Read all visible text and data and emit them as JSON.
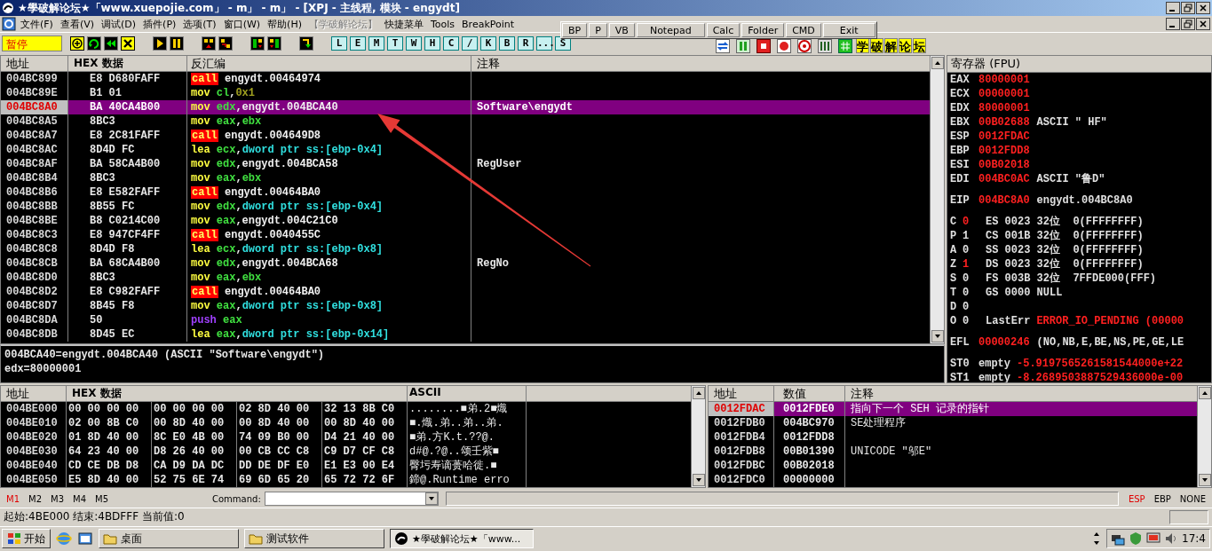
{
  "window": {
    "title": "★學破解论坛★「www.xuepojie.com」 - m」 - m」 - [XPJ - 主线程, 模块 - engydt]"
  },
  "menu": [
    {
      "label": "文件(F)",
      "disabled": false
    },
    {
      "label": "查看(V)",
      "disabled": false
    },
    {
      "label": "调试(D)",
      "disabled": false
    },
    {
      "label": "插件(P)",
      "disabled": false
    },
    {
      "label": "选项(T)",
      "disabled": false
    },
    {
      "label": "窗口(W)",
      "disabled": false
    },
    {
      "label": "帮助(H)",
      "disabled": false
    },
    {
      "label": "【学破解论坛】",
      "disabled": true
    },
    {
      "label": "快捷菜单",
      "disabled": false
    },
    {
      "label": "Tools",
      "disabled": false
    },
    {
      "label": "BreakPoint",
      "disabled": false
    }
  ],
  "quick_tools": [
    "BP",
    "P",
    "VB",
    "Notepad",
    "Calc",
    "Folder",
    "CMD",
    "Exit"
  ],
  "toolbar": {
    "status": "暂停",
    "letter_buttons": [
      "L",
      "E",
      "M",
      "T",
      "W",
      "H",
      "C",
      "/",
      "K",
      "B",
      "R",
      "...",
      "S"
    ],
    "forum_buttons": [
      "学",
      "破",
      "解",
      "论",
      "坛"
    ]
  },
  "cpu": {
    "columns": [
      "地址",
      "HEX 数据",
      "反汇编",
      "注释"
    ],
    "rows": [
      {
        "address": "004BC899",
        "hex": "E8 D680FAFF",
        "kind": "call",
        "mnemonic": "call",
        "operands": [
          {
            "text": "engydt.00464974",
            "kind": "plain"
          }
        ],
        "selected": false
      },
      {
        "address": "004BC89E",
        "hex": "B1 01",
        "kind": "move",
        "mnemonic": "mov",
        "operands": [
          {
            "text": "cl",
            "kind": "register"
          },
          {
            "text": ",",
            "kind": "plain"
          },
          {
            "text": "0x1",
            "kind": "constant"
          }
        ],
        "selected": false
      },
      {
        "address": "004BC8A0",
        "hex": "BA 40CA4B00",
        "kind": "move",
        "mnemonic": "mov",
        "operands": [
          {
            "text": "edx",
            "kind": "register"
          },
          {
            "text": ",engydt.004BCA40",
            "kind": "plain"
          }
        ],
        "comment": "Software\\engydt",
        "selected": true
      },
      {
        "address": "004BC8A5",
        "hex": "8BC3",
        "kind": "move",
        "mnemonic": "mov",
        "operands": [
          {
            "text": "eax",
            "kind": "register"
          },
          {
            "text": ",",
            "kind": "plain"
          },
          {
            "text": "ebx",
            "kind": "register"
          }
        ],
        "selected": false
      },
      {
        "address": "004BC8A7",
        "hex": "E8 2C81FAFF",
        "kind": "call",
        "mnemonic": "call",
        "operands": [
          {
            "text": "engydt.004649D8",
            "kind": "plain"
          }
        ],
        "selected": false
      },
      {
        "address": "004BC8AC",
        "hex": "8D4D FC",
        "kind": "move",
        "mnemonic": "lea",
        "operands": [
          {
            "text": "ecx",
            "kind": "register"
          },
          {
            "text": ",",
            "kind": "plain"
          },
          {
            "text": "dword ptr ss:[ebp-0x4]",
            "kind": "memory"
          }
        ],
        "selected": false
      },
      {
        "address": "004BC8AF",
        "hex": "BA 58CA4B00",
        "kind": "move",
        "mnemonic": "mov",
        "operands": [
          {
            "text": "edx",
            "kind": "register"
          },
          {
            "text": ",engydt.004BCA58",
            "kind": "plain"
          }
        ],
        "comment": "RegUser",
        "selected": false
      },
      {
        "address": "004BC8B4",
        "hex": "8BC3",
        "kind": "move",
        "mnemonic": "mov",
        "operands": [
          {
            "text": "eax",
            "kind": "register"
          },
          {
            "text": ",",
            "kind": "plain"
          },
          {
            "text": "ebx",
            "kind": "register"
          }
        ],
        "selected": false
      },
      {
        "address": "004BC8B6",
        "hex": "E8 E582FAFF",
        "kind": "call",
        "mnemonic": "call",
        "operands": [
          {
            "text": "engydt.00464BA0",
            "kind": "plain"
          }
        ],
        "selected": false
      },
      {
        "address": "004BC8BB",
        "hex": "8B55 FC",
        "kind": "move",
        "mnemonic": "mov",
        "operands": [
          {
            "text": "edx",
            "kind": "register"
          },
          {
            "text": ",",
            "kind": "plain"
          },
          {
            "text": "dword ptr ss:[ebp-0x4]",
            "kind": "memory"
          }
        ],
        "selected": false
      },
      {
        "address": "004BC8BE",
        "hex": "B8 C0214C00",
        "kind": "move",
        "mnemonic": "mov",
        "operands": [
          {
            "text": "eax",
            "kind": "register"
          },
          {
            "text": ",engydt.004C21C0",
            "kind": "plain"
          }
        ],
        "selected": false
      },
      {
        "address": "004BC8C3",
        "hex": "E8 947CF4FF",
        "kind": "call",
        "mnemonic": "call",
        "operands": [
          {
            "text": "engydt.0040455C",
            "kind": "plain"
          }
        ],
        "selected": false
      },
      {
        "address": "004BC8C8",
        "hex": "8D4D F8",
        "kind": "move",
        "mnemonic": "lea",
        "operands": [
          {
            "text": "ecx",
            "kind": "register"
          },
          {
            "text": ",",
            "kind": "plain"
          },
          {
            "text": "dword ptr ss:[ebp-0x8]",
            "kind": "memory"
          }
        ],
        "selected": false
      },
      {
        "address": "004BC8CB",
        "hex": "BA 68CA4B00",
        "kind": "move",
        "mnemonic": "mov",
        "operands": [
          {
            "text": "edx",
            "kind": "register"
          },
          {
            "text": ",engydt.004BCA68",
            "kind": "plain"
          }
        ],
        "comment": "RegNo",
        "selected": false
      },
      {
        "address": "004BC8D0",
        "hex": "8BC3",
        "kind": "move",
        "mnemonic": "mov",
        "operands": [
          {
            "text": "eax",
            "kind": "register"
          },
          {
            "text": ",",
            "kind": "plain"
          },
          {
            "text": "ebx",
            "kind": "register"
          }
        ],
        "selected": false
      },
      {
        "address": "004BC8D2",
        "hex": "E8 C982FAFF",
        "kind": "call",
        "mnemonic": "call",
        "operands": [
          {
            "text": "engydt.00464BA0",
            "kind": "plain"
          }
        ],
        "selected": false
      },
      {
        "address": "004BC8D7",
        "hex": "8B45 F8",
        "kind": "move",
        "mnemonic": "mov",
        "operands": [
          {
            "text": "eax",
            "kind": "register"
          },
          {
            "text": ",",
            "kind": "plain"
          },
          {
            "text": "dword ptr ss:[ebp-0x8]",
            "kind": "memory"
          }
        ],
        "selected": false
      },
      {
        "address": "004BC8DA",
        "hex": "50",
        "kind": "stack",
        "mnemonic": "push",
        "operands": [
          {
            "text": "eax",
            "kind": "register"
          }
        ],
        "selected": false
      },
      {
        "address": "004BC8DB",
        "hex": "8D45 EC",
        "kind": "move",
        "mnemonic": "lea",
        "operands": [
          {
            "text": "eax",
            "kind": "register"
          },
          {
            "text": ",",
            "kind": "plain"
          },
          {
            "text": "dword ptr ss:[ebp-0x14]",
            "kind": "memory"
          }
        ],
        "selected": false
      }
    ]
  },
  "info": [
    "004BCA40=engydt.004BCA40 (ASCII \"Software\\engydt\")",
    "edx=80000001"
  ],
  "registers": {
    "title": "寄存器 (FPU)",
    "general": [
      {
        "name": "EAX",
        "value": "80000001",
        "changed": true
      },
      {
        "name": "ECX",
        "value": "00000001",
        "changed": true
      },
      {
        "name": "EDX",
        "value": "80000001",
        "changed": true
      },
      {
        "name": "EBX",
        "value": "00B02688",
        "changed": true,
        "comment": "ASCII \" HF\""
      },
      {
        "name": "ESP",
        "value": "0012FDAC",
        "changed": true
      },
      {
        "name": "EBP",
        "value": "0012FDD8",
        "changed": true
      },
      {
        "name": "ESI",
        "value": "00B02018",
        "changed": true
      },
      {
        "name": "EDI",
        "value": "004BC0AC",
        "changed": true,
        "comment": "ASCII \"鲁D\""
      }
    ],
    "eip": {
      "name": "EIP",
      "value": "004BC8A0",
      "changed": true,
      "comment": "engydt.004BC8A0"
    },
    "flags": [
      {
        "name": "C",
        "value": "0",
        "changed": true,
        "detail": "ES 0023 32位  0(FFFFFFFF)"
      },
      {
        "name": "P",
        "value": "1",
        "changed": false,
        "detail": "CS 001B 32位  0(FFFFFFFF)"
      },
      {
        "name": "A",
        "value": "0",
        "changed": false,
        "detail": "SS 0023 32位  0(FFFFFFFF)"
      },
      {
        "name": "Z",
        "value": "1",
        "changed": true,
        "detail": "DS 0023 32位  0(FFFFFFFF)"
      },
      {
        "name": "S",
        "value": "0",
        "changed": false,
        "detail": "FS 003B 32位  7FFDE000(FFF)"
      },
      {
        "name": "T",
        "value": "0",
        "changed": false,
        "detail": "GS 0000 NULL"
      },
      {
        "name": "D",
        "value": "0",
        "changed": false
      },
      {
        "name": "O",
        "value": "0",
        "changed": false,
        "detail": "LastErr",
        "error": "ERROR_IO_PENDING (00000"
      }
    ],
    "efl": {
      "name": "EFL",
      "value": "00000246",
      "changed": true,
      "comment": "(NO,NB,E,BE,NS,PE,GE,LE"
    },
    "fpu": [
      {
        "name": "ST0",
        "tag": "empty",
        "value": "-5.9197565261581544000e+22"
      },
      {
        "name": "ST1",
        "tag": "empty",
        "value": "-8.2689503887529436000e-00"
      }
    ]
  },
  "dump": {
    "columns": [
      "地址",
      "HEX 数据",
      "ASCII"
    ],
    "rows": [
      {
        "address": "004BE000",
        "hex": [
          "00 00 00 00",
          "00 00 00 00",
          "02 8D 40 00",
          "32 13 8B C0"
        ],
        "ascii": "........■弟.2■熾"
      },
      {
        "address": "004BE010",
        "hex": [
          "02 00 8B C0",
          "00 8D 40 00",
          "00 8D 40 00",
          "00 8D 40 00"
        ],
        "ascii": "■.熾.弟..弟..弟."
      },
      {
        "address": "004BE020",
        "hex": [
          "01 8D 40 00",
          "8C E0 4B 00",
          "74 09 B0 00",
          "D4 21 40 00"
        ],
        "ascii": "■弟.方K.t.??@."
      },
      {
        "address": "004BE030",
        "hex": [
          "64 23 40 00",
          "D8 26 40 00",
          "00 CB CC C8",
          "C9 D7 CF C8"
        ],
        "ascii": "d#@.?@..颂壬紫■"
      },
      {
        "address": "004BE040",
        "hex": [
          "CD CE DB D8",
          "CA D9 DA DC",
          "DD DE DF E0",
          "E1 E3 00 E4"
        ],
        "ascii": "臀圬寿谪蒉哈徙.■"
      },
      {
        "address": "004BE050",
        "hex": [
          "E5 8D 40 00",
          "52 75 6E 74",
          "69 6D 65 20",
          "65 72 72 6F"
        ],
        "ascii": "鍗@.Runtime erro"
      }
    ]
  },
  "stack": {
    "columns": [
      "地址",
      "数值",
      "注释"
    ],
    "rows": [
      {
        "address": "0012FDAC",
        "value": "0012FDE0",
        "comment": "指向下一个 SEH 记录的指针",
        "selected": true
      },
      {
        "address": "0012FDB0",
        "value": "004BC970",
        "comment": "SE处理程序",
        "selected": false
      },
      {
        "address": "0012FDB4",
        "value": "0012FDD8",
        "selected": false
      },
      {
        "address": "0012FDB8",
        "value": "00B01390",
        "comment": "UNICODE \"邬E\"",
        "selected": false
      },
      {
        "address": "0012FDBC",
        "value": "00B02018",
        "selected": false
      },
      {
        "address": "0012FDC0",
        "value": "00000000",
        "selected": false
      }
    ]
  },
  "bookmarks": [
    {
      "label": "M1",
      "selected": true
    },
    {
      "label": "M2",
      "selected": false
    },
    {
      "label": "M3",
      "selected": false
    },
    {
      "label": "M4",
      "selected": false
    },
    {
      "label": "M5",
      "selected": false
    }
  ],
  "command": {
    "label": "Command:"
  },
  "stack_anchor": [
    {
      "label": "ESP",
      "selected": true
    },
    {
      "label": "EBP",
      "selected": false
    },
    {
      "label": "NONE",
      "selected": false
    }
  ],
  "status_bar": "起始:4BE000 结束:4BDFFF 当前值:0",
  "taskbar": {
    "start": "开始",
    "tasks": [
      {
        "label": "桌面",
        "selected": false
      },
      {
        "label": "测试软件",
        "selected": false
      },
      {
        "label": "★學破解论坛★「www...",
        "selected": true
      }
    ],
    "clock": "17:4"
  }
}
